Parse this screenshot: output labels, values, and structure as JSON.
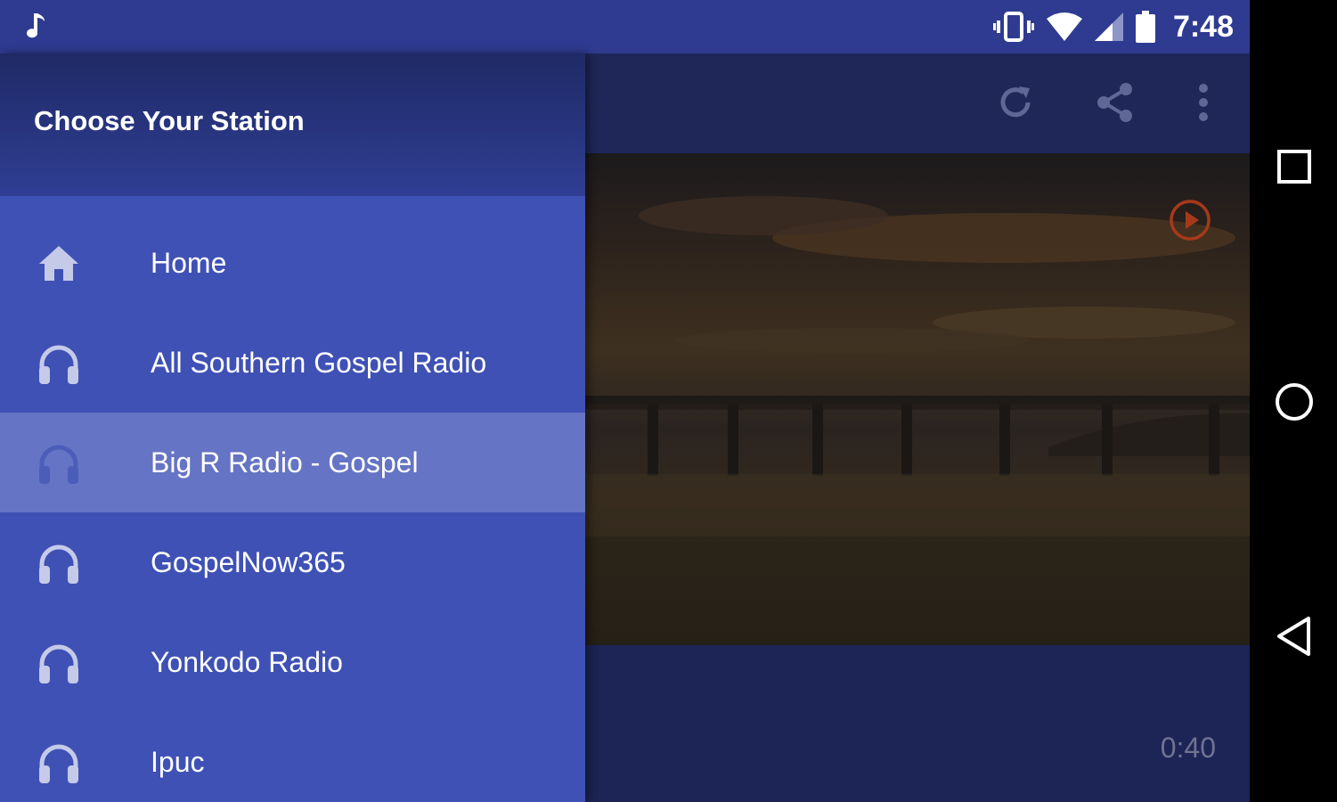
{
  "status_bar": {
    "time": "7:48",
    "left_icon": "music-note-icon",
    "right_icons": [
      "vibrate-icon",
      "wifi-icon",
      "cell-signal-icon",
      "battery-icon"
    ]
  },
  "toolbar": {
    "icons": [
      "refresh-icon",
      "share-icon",
      "more-vert-icon"
    ]
  },
  "player": {
    "elapsed": "0:40",
    "play_icon": "play-circle-icon",
    "accent_color": "#d84315"
  },
  "drawer": {
    "title": "Choose Your Station",
    "items": [
      {
        "label": "Home",
        "icon": "home-icon",
        "active": false
      },
      {
        "label": "All Southern Gospel Radio",
        "icon": "headphones-icon",
        "active": false
      },
      {
        "label": "Big R Radio - Gospel",
        "icon": "headphones-icon",
        "active": true
      },
      {
        "label": "GospelNow365",
        "icon": "headphones-icon",
        "active": false
      },
      {
        "label": "Yonkodo Radio",
        "icon": "headphones-icon",
        "active": false
      },
      {
        "label": "Ipuc",
        "icon": "headphones-icon",
        "active": false
      }
    ]
  },
  "nav_bar": {
    "icons": [
      "recents-square-icon",
      "home-circle-icon",
      "back-triangle-icon"
    ]
  },
  "colors": {
    "status_bar": "#2f3b91",
    "drawer": "#3f51b5",
    "drawer_active": "#6574c4",
    "main_bg": "#1d2456"
  }
}
